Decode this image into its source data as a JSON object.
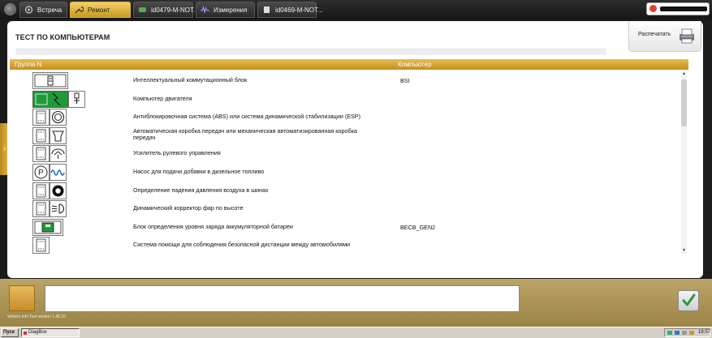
{
  "tabs": [
    {
      "label": "Встреча",
      "active": false
    },
    {
      "label": "Ремонт",
      "active": true
    },
    {
      "label": "id0479-M-NOT...",
      "active": false
    },
    {
      "label": "Измерения",
      "active": false
    },
    {
      "label": "id0469-M-NOT...",
      "active": false
    }
  ],
  "page": {
    "title": "ТЕСТ ПО КОМПЬЮТЕРАМ",
    "print_label": "Распечатать"
  },
  "table": {
    "col_group": "Группа N",
    "col_computer": "Компьютер",
    "rows": [
      {
        "name": "Интеллектуальный коммутационный блок",
        "computer": "BSI",
        "icon": "bsi-module-icon"
      },
      {
        "name": "Компьютер двигателя",
        "computer": "",
        "icon": "engine-ecu-icon"
      },
      {
        "name": "Антиблокировочная система (ABS) или система динамической стабилизации (ESP)",
        "computer": "",
        "icon": "abs-esp-icon"
      },
      {
        "name": "Автоматическая коробка передач или механическая автоматизированная коробка\nпередач",
        "computer": "",
        "icon": "gearbox-icon"
      },
      {
        "name": "Усилитель рулевого управления",
        "computer": "",
        "icon": "steering-icon"
      },
      {
        "name": "Насос для подачи добавки в дизельное топливо",
        "computer": "",
        "icon": "additive-pump-icon"
      },
      {
        "name": "Определение падения давления воздуха в шинах",
        "computer": "",
        "icon": "tire-pressure-icon"
      },
      {
        "name": "Динамический корректор фар по высоте",
        "computer": "",
        "icon": "headlamp-corrector-icon"
      },
      {
        "name": "Блок определения уровня заряда аккумуляторной батареи",
        "computer": "BECB_GEN2",
        "icon": "battery-module-icon"
      },
      {
        "name": "Система помощи для соблюдения безопасной дистанции между автомобилями",
        "computer": "",
        "icon": "distance-assist-icon"
      }
    ]
  },
  "bottom": {
    "message": "",
    "version": "Vehicle Info Tool version 1.45.10"
  },
  "taskbar": {
    "start_label": "Пуск",
    "task_label": "DiagBox",
    "clock": "19:57"
  },
  "colors": {
    "accent": "#d9a933",
    "module_green": "#1f9a3a"
  }
}
